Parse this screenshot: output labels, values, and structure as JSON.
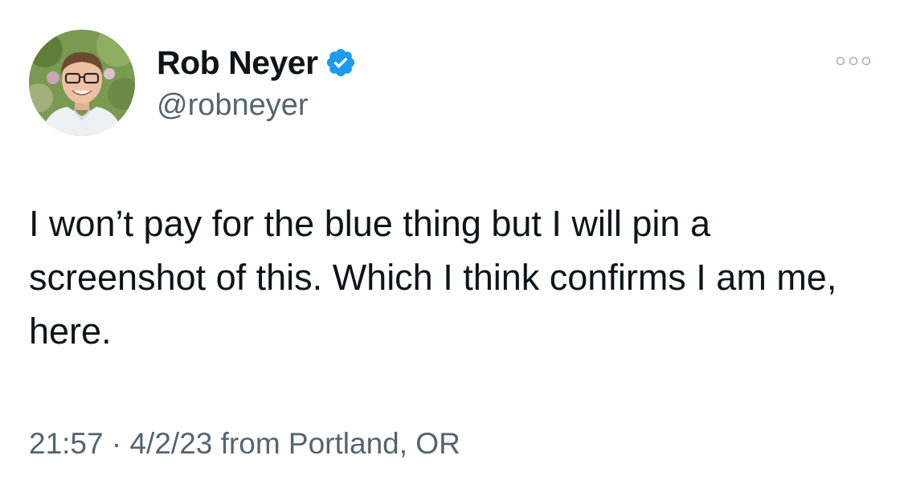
{
  "author": {
    "name": "Rob Neyer",
    "handle": "@robneyer",
    "verified": true,
    "verified_badge_color": "#1d9bf0"
  },
  "icons": {
    "more": "more-horizontal-icon",
    "verified": "verified-badge-icon"
  },
  "tweet": {
    "text": "I won’t pay for the blue thing but I will pin a screenshot of this. Which I think confirms I am me, here."
  },
  "meta": {
    "time": "21:57",
    "separator": " · ",
    "date": "4/2/23",
    "location": " from Portland, OR"
  },
  "colors": {
    "text_primary": "#0f1419",
    "text_secondary": "#536471",
    "background": "#ffffff"
  }
}
